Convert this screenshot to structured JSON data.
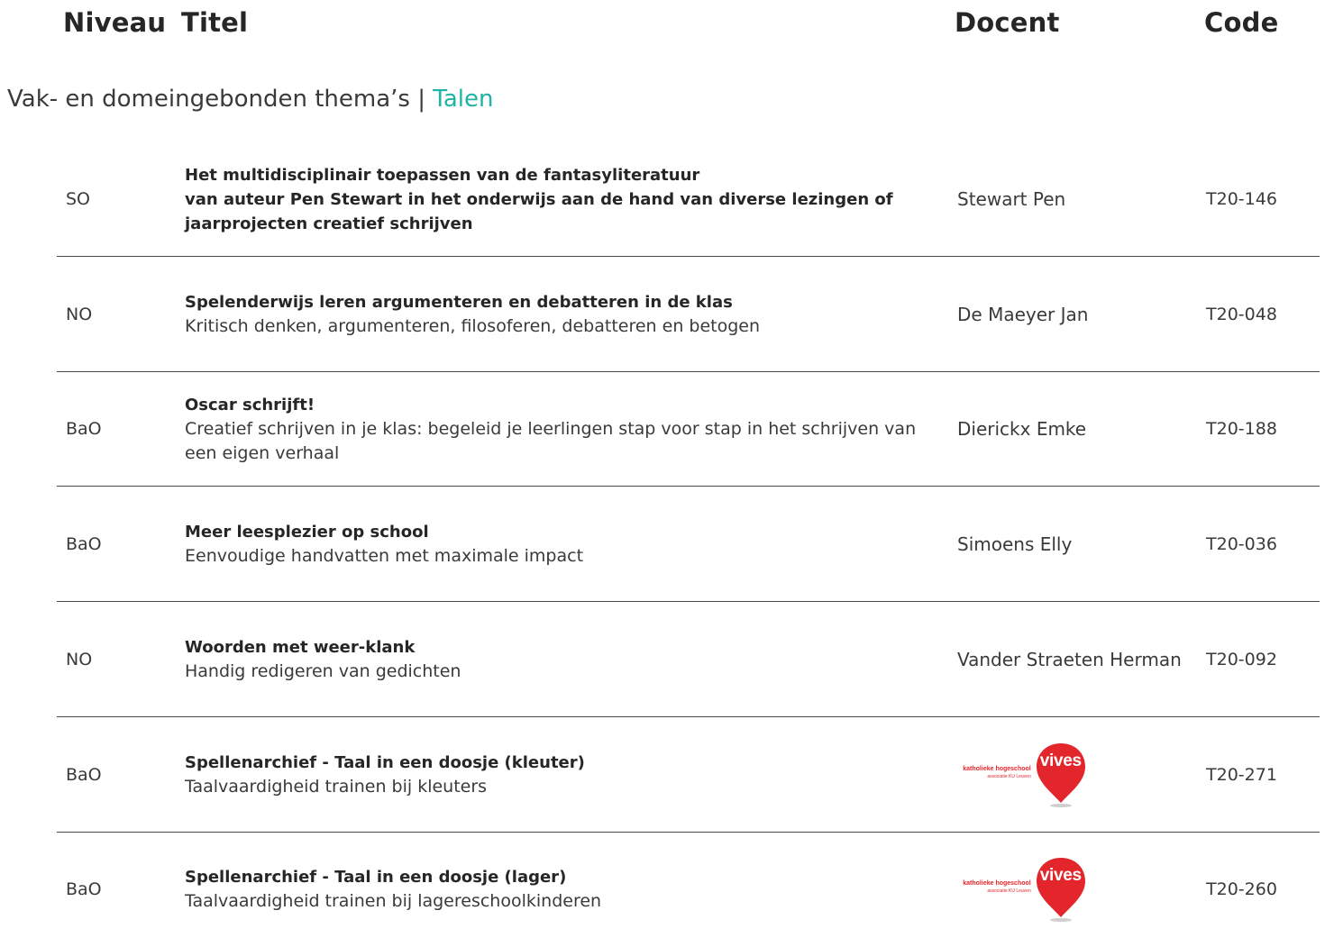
{
  "header": {
    "level": "Niveau",
    "title": "Titel",
    "teacher": "Docent",
    "code": "Code"
  },
  "section": {
    "prefix": "Vak- en domeingebonden thema’s | ",
    "accent": "Talen",
    "accent_color": "#1fb3a6"
  },
  "logo": {
    "line1": "katholieke hogeschool",
    "line2": "associatie KU Leuven",
    "word": "vives",
    "color": "#e3262c"
  },
  "rows": [
    {
      "level": "SO",
      "title_lines": [
        "Het multidisciplinair toepassen van de  fantasyliteratuur",
        "van auteur Pen Stewart in het onderwijs aan de hand van  diverse lezingen of",
        "jaarprojecten creatief schrijven"
      ],
      "subtitle": "",
      "teacher": "Stewart Pen",
      "code": "T20-146"
    },
    {
      "level": "NO",
      "title_lines": [
        "Spelenderwijs leren argumenteren en debatteren in de klas"
      ],
      "subtitle": "Kritisch denken, argumenteren, filosoferen, debatteren en betogen",
      "teacher": "De Maeyer Jan",
      "code": "T20-048"
    },
    {
      "level": "BaO",
      "title_lines": [
        "Oscar schrijft!"
      ],
      "subtitle": "Creatief schrijven in je klas: begeleid je leerlingen stap voor stap in het schrijven van een eigen verhaal",
      "teacher": "Dierickx Emke",
      "code": "T20-188"
    },
    {
      "level": "BaO",
      "title_lines": [
        "Meer leesplezier op school"
      ],
      "subtitle": "Eenvoudige handvatten met maximale impact",
      "teacher": "Simoens Elly",
      "code": "T20-036"
    },
    {
      "level": "NO",
      "title_lines": [
        "Woorden met weer-klank"
      ],
      "subtitle": "Handig redigeren van gedichten",
      "teacher": "Vander Straeten Herman",
      "code": "T20-092"
    },
    {
      "level": "BaO",
      "title_lines": [
        "Spellenarchief - Taal in een doosje (kleuter)"
      ],
      "subtitle": "Taalvaardigheid trainen bij kleuters",
      "teacher": "",
      "teacher_logo": true,
      "code": "T20-271"
    },
    {
      "level": "BaO",
      "title_lines": [
        "Spellenarchief - Taal in een doosje (lager)"
      ],
      "subtitle": "Taalvaardigheid trainen bij lagereschoolkinderen",
      "teacher": "",
      "teacher_logo": true,
      "code": "T20-260"
    }
  ]
}
